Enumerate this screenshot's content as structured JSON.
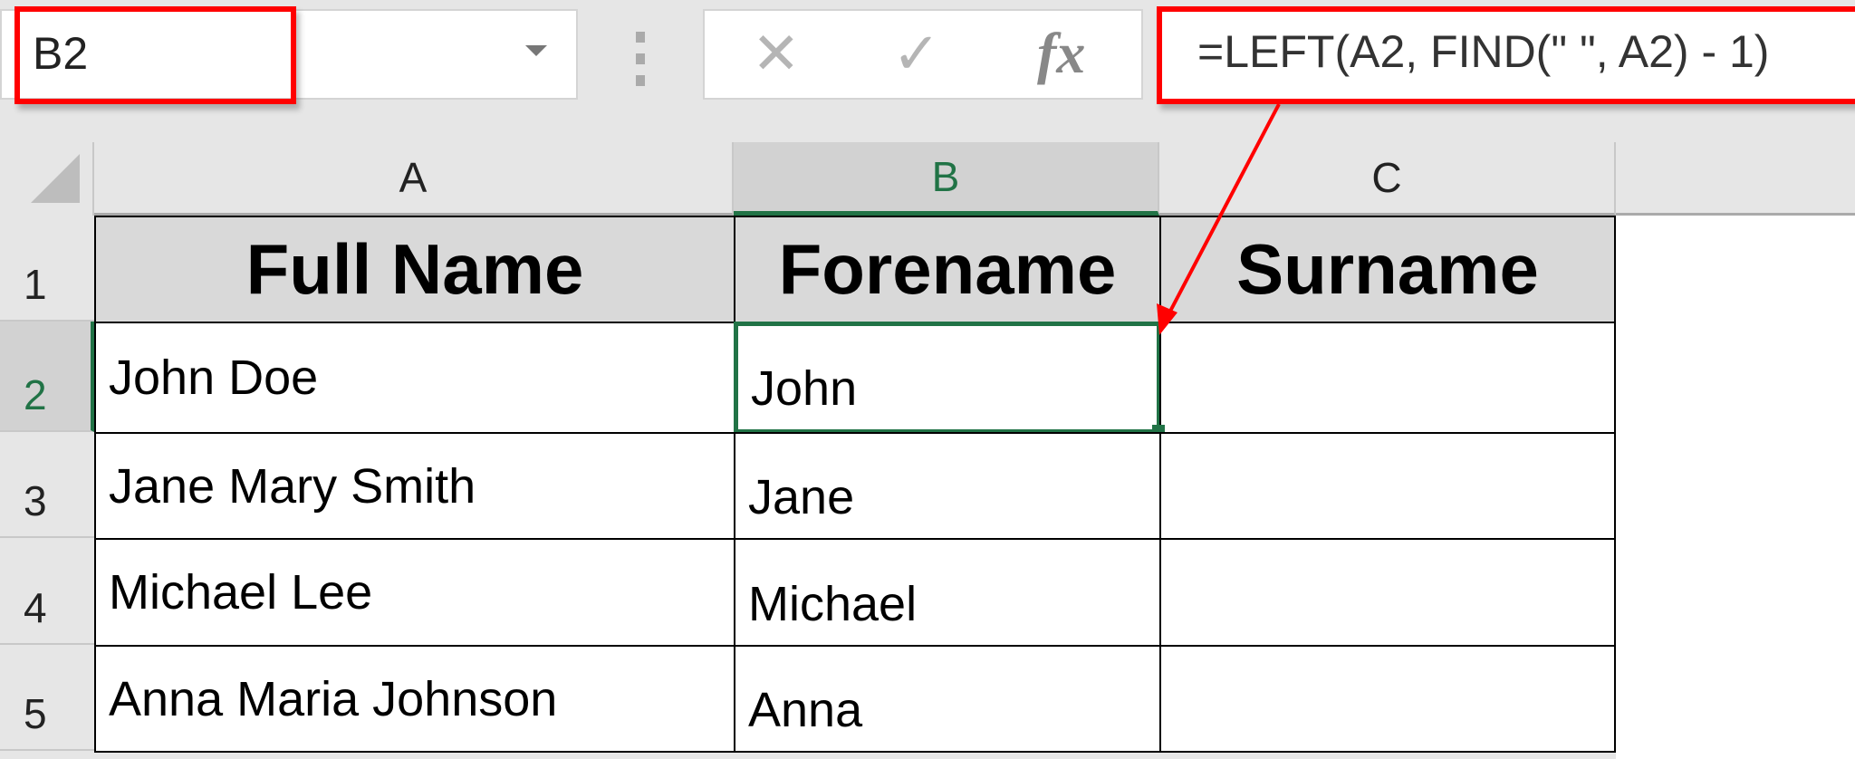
{
  "name_box": {
    "value": "B2"
  },
  "formula_bar": {
    "cancel_icon": "✕",
    "enter_icon": "✓",
    "fx_label": "fx",
    "formula": "=LEFT(A2, FIND(\" \", A2) - 1)"
  },
  "columns": [
    "A",
    "B",
    "C"
  ],
  "rows": [
    "1",
    "2",
    "3",
    "4",
    "5"
  ],
  "headers": {
    "a": "Full Name",
    "b": "Forename",
    "c": "Surname"
  },
  "data": [
    {
      "full": "John Doe",
      "fore": "John",
      "sur": ""
    },
    {
      "full": "Jane Mary Smith",
      "fore": "Jane",
      "sur": ""
    },
    {
      "full": "Michael Lee",
      "fore": "Michael",
      "sur": ""
    },
    {
      "full": "Anna Maria Johnson",
      "fore": "Anna",
      "sur": ""
    }
  ],
  "colors": {
    "highlight": "#ff0000",
    "selection": "#217346"
  }
}
